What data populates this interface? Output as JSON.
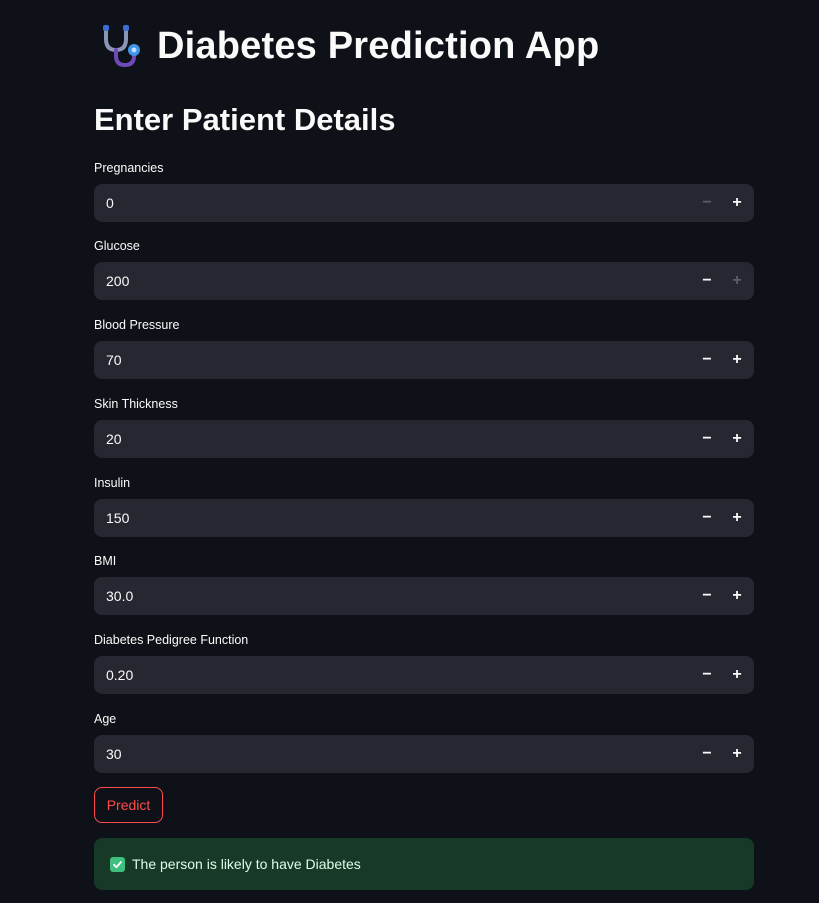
{
  "header": {
    "title": "Diabetes Prediction App",
    "icon": "stethoscope-icon"
  },
  "section": {
    "title": "Enter Patient Details"
  },
  "fields": [
    {
      "label": "Pregnancies",
      "value": "0",
      "minus_disabled": true,
      "plus_disabled": false
    },
    {
      "label": "Glucose",
      "value": "200",
      "minus_disabled": false,
      "plus_disabled": true
    },
    {
      "label": "Blood Pressure",
      "value": "70",
      "minus_disabled": false,
      "plus_disabled": false
    },
    {
      "label": "Skin Thickness",
      "value": "20",
      "minus_disabled": false,
      "plus_disabled": false
    },
    {
      "label": "Insulin",
      "value": "150",
      "minus_disabled": false,
      "plus_disabled": false
    },
    {
      "label": "BMI",
      "value": "30.0",
      "minus_disabled": false,
      "plus_disabled": false
    },
    {
      "label": "Diabetes Pedigree Function",
      "value": "0.20",
      "minus_disabled": false,
      "plus_disabled": false
    },
    {
      "label": "Age",
      "value": "30",
      "minus_disabled": false,
      "plus_disabled": false
    }
  ],
  "stepper": {
    "minus": "−",
    "plus": "+"
  },
  "predict_button": {
    "label": "Predict"
  },
  "result": {
    "icon": "check-icon",
    "text": "The person is likely to have Diabetes"
  },
  "colors": {
    "background": "#0e1117",
    "input_bg": "#262730",
    "accent": "#ff4b4b",
    "success_bg": "#173928",
    "success_icon": "#3fbf7f"
  }
}
